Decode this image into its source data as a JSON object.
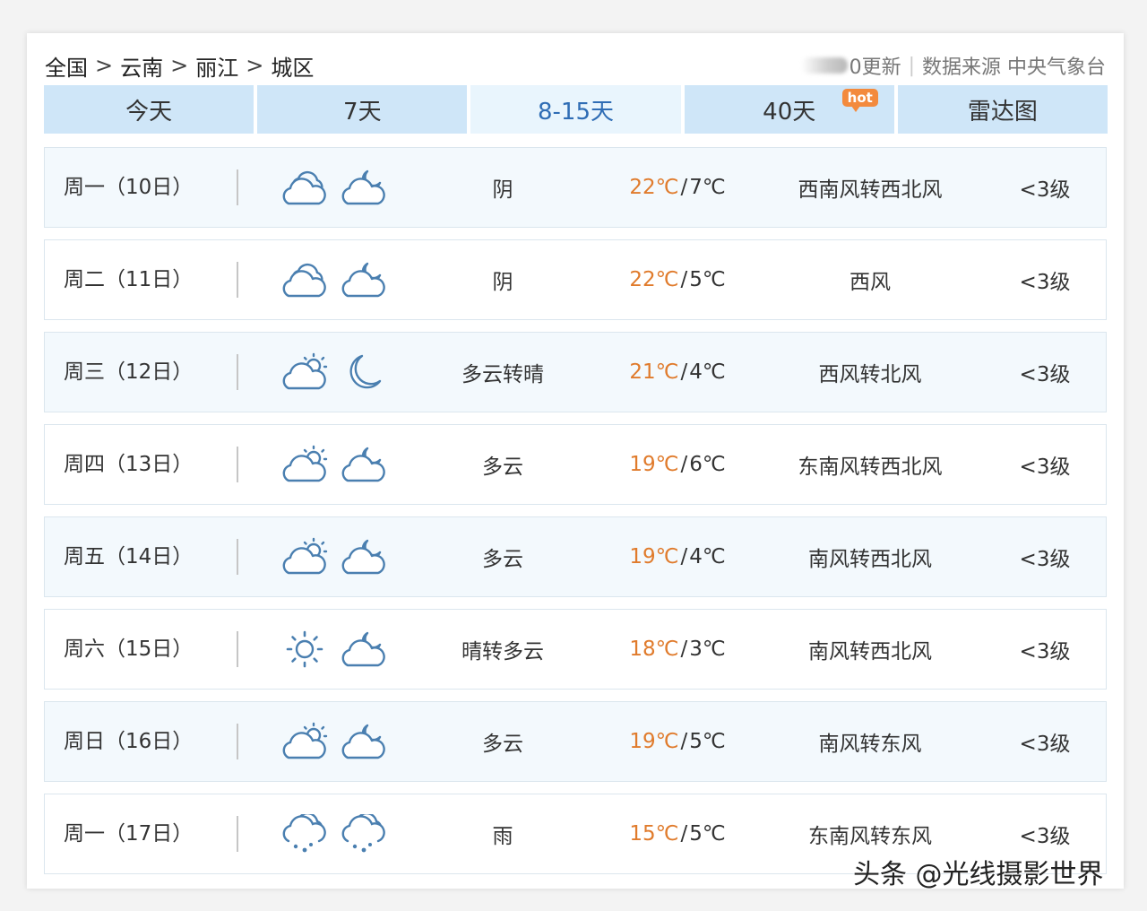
{
  "breadcrumb": {
    "items": [
      "全国",
      "云南",
      "丽江",
      "城区"
    ],
    "separator": ">"
  },
  "meta": {
    "update_text": "0更新",
    "source_text": "数据来源 中央气象台"
  },
  "tabs": [
    {
      "label": "今天",
      "active": false
    },
    {
      "label": "7天",
      "active": false
    },
    {
      "label": "8-15天",
      "active": true
    },
    {
      "label": "40天",
      "active": false,
      "badge": "hot"
    },
    {
      "label": "雷达图",
      "active": false
    }
  ],
  "forecast": [
    {
      "day": "周一（10日）",
      "icon_day": "overcast-cloud-icon",
      "icon_night": "cloud-moon-icon",
      "desc": "阴",
      "high": "22℃",
      "low": "7℃",
      "wind": "西南风转西北风",
      "level": "<3级"
    },
    {
      "day": "周二（11日）",
      "icon_day": "overcast-cloud-icon",
      "icon_night": "cloud-moon-icon",
      "desc": "阴",
      "high": "22℃",
      "low": "5℃",
      "wind": "西风",
      "level": "<3级"
    },
    {
      "day": "周三（12日）",
      "icon_day": "partly-cloudy-sun-icon",
      "icon_night": "crescent-moon-icon",
      "desc": "多云转晴",
      "high": "21℃",
      "low": "4℃",
      "wind": "西风转北风",
      "level": "<3级"
    },
    {
      "day": "周四（13日）",
      "icon_day": "partly-cloudy-sun-icon",
      "icon_night": "cloud-moon-icon",
      "desc": "多云",
      "high": "19℃",
      "low": "6℃",
      "wind": "东南风转西北风",
      "level": "<3级"
    },
    {
      "day": "周五（14日）",
      "icon_day": "partly-cloudy-sun-icon",
      "icon_night": "cloud-moon-icon",
      "desc": "多云",
      "high": "19℃",
      "low": "4℃",
      "wind": "南风转西北风",
      "level": "<3级"
    },
    {
      "day": "周六（15日）",
      "icon_day": "sun-icon",
      "icon_night": "cloud-moon-icon",
      "desc": "晴转多云",
      "high": "18℃",
      "low": "3℃",
      "wind": "南风转西北风",
      "level": "<3级"
    },
    {
      "day": "周日（16日）",
      "icon_day": "partly-cloudy-sun-icon",
      "icon_night": "cloud-moon-icon",
      "desc": "多云",
      "high": "19℃",
      "low": "5℃",
      "wind": "南风转东风",
      "level": "<3级"
    },
    {
      "day": "周一（17日）",
      "icon_day": "rain-cloud-icon",
      "icon_night": "rain-cloud-icon",
      "desc": "雨",
      "high": "15℃",
      "low": "5℃",
      "wind": "东南风转东风",
      "level": "<3级"
    }
  ],
  "temp_separator": "/",
  "watermark": "头条 @光线摄影世界",
  "colors": {
    "tab_bg": "#cfe6f8",
    "tab_active_bg": "#e9f5fd",
    "tab_active_text": "#2f6db5",
    "row_alt_bg": "#f3f9fd",
    "high_temp": "#e07b2c",
    "icon_stroke": "#4a7fb0",
    "hot_badge": "#f38a3d"
  }
}
